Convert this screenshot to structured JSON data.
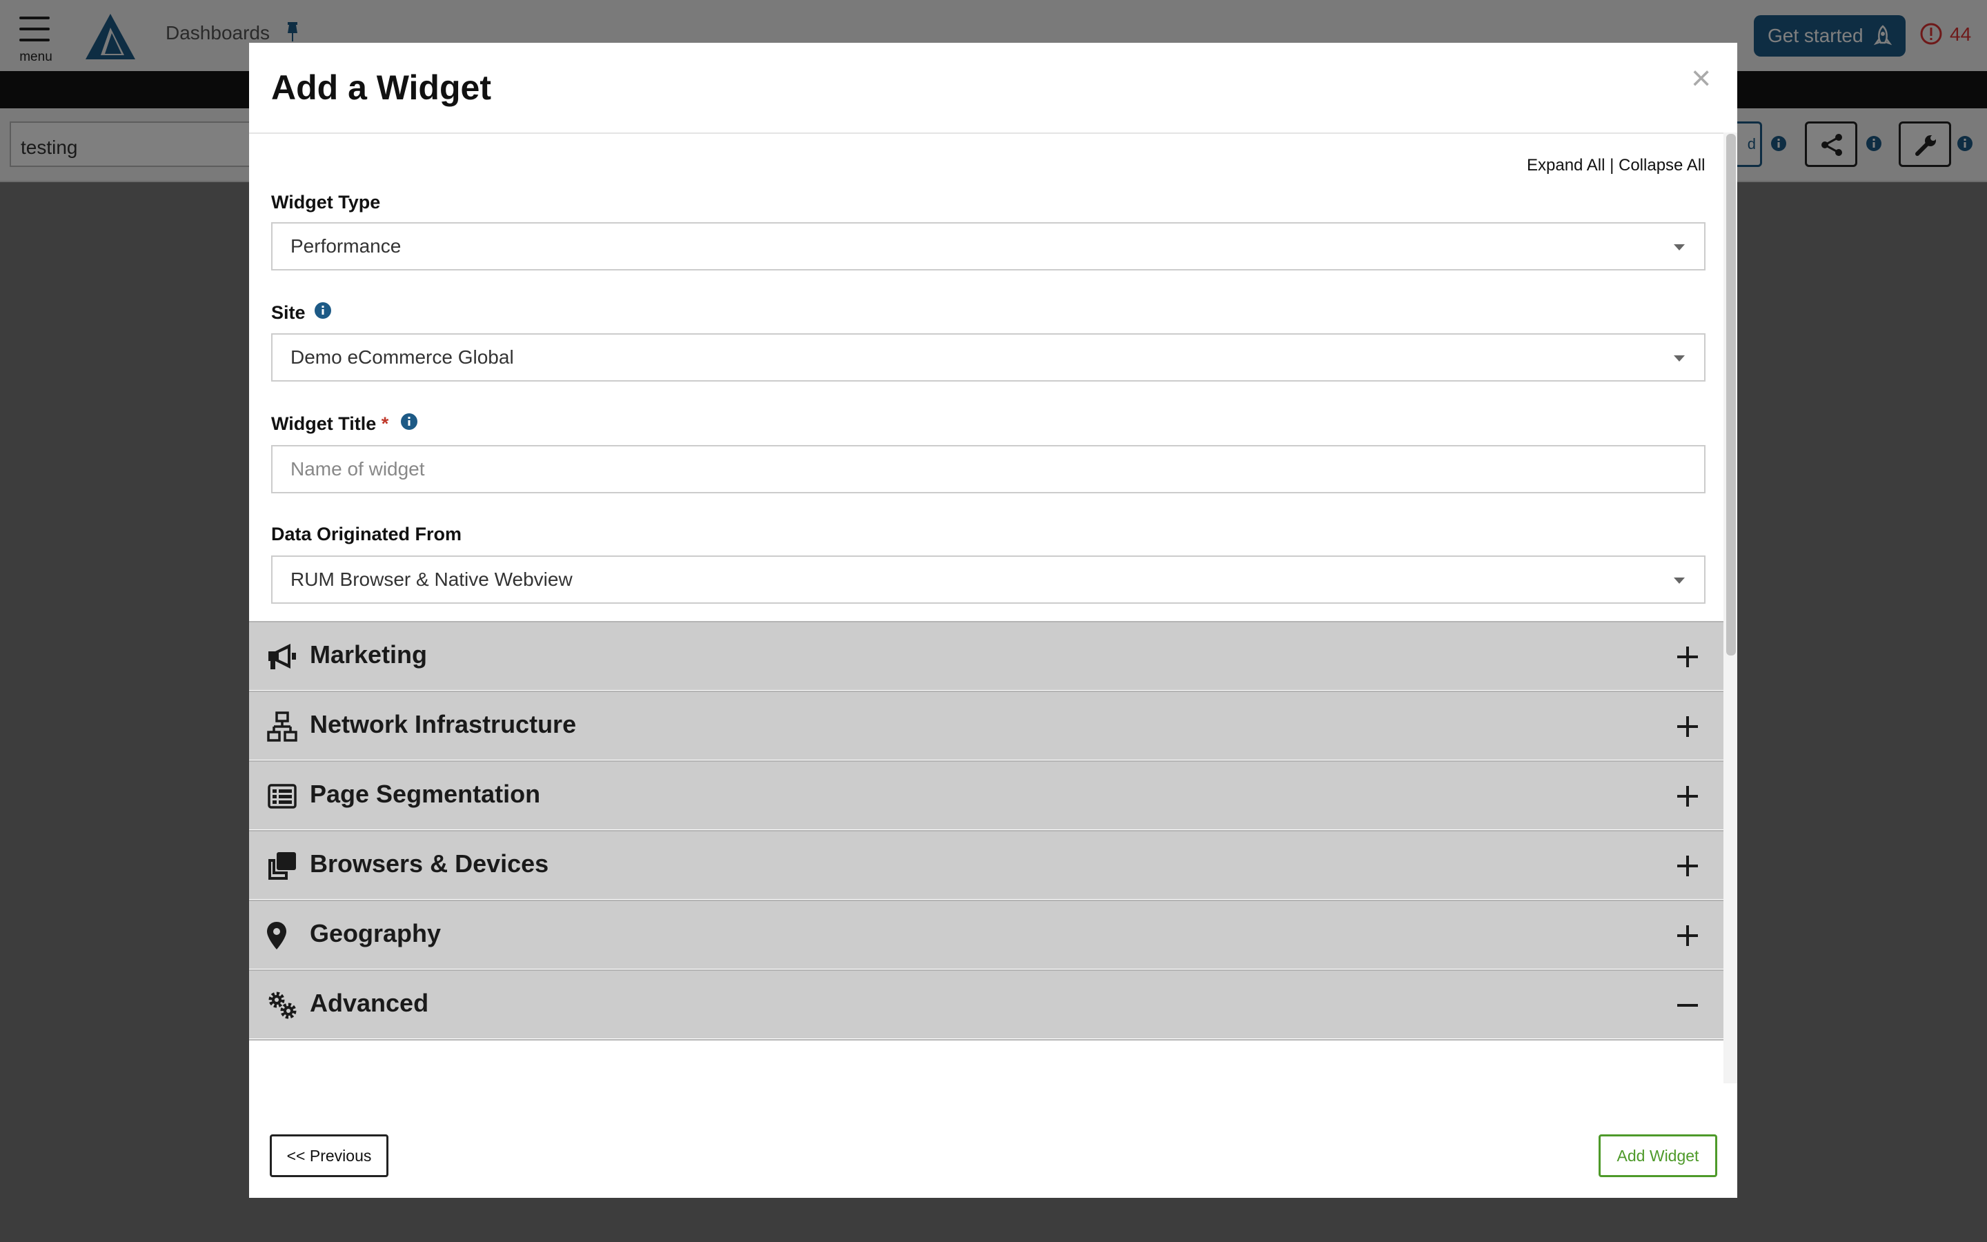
{
  "topbar": {
    "menu_label": "menu",
    "breadcrumb": "Dashboards",
    "get_started_label": "Get started",
    "alert_count": "44"
  },
  "toolbar": {
    "dashboard_name": "testing",
    "partial_button_text": "d"
  },
  "modal": {
    "title": "Add a Widget",
    "close_symbol": "×",
    "expand_all": "Expand All",
    "link_separator": "|",
    "collapse_all": "Collapse All",
    "fields": {
      "widget_type": {
        "label": "Widget Type",
        "value": "Performance"
      },
      "site": {
        "label": "Site",
        "value": "Demo eCommerce Global"
      },
      "widget_title": {
        "label": "Widget Title",
        "required_mark": "*",
        "placeholder": "Name of widget"
      },
      "data_origin": {
        "label": "Data Originated From",
        "value": "RUM Browser & Native Webview"
      }
    },
    "sections": [
      {
        "title": "Marketing",
        "icon": "megaphone-icon",
        "expanded": false
      },
      {
        "title": "Network Infrastructure",
        "icon": "network-icon",
        "expanded": false
      },
      {
        "title": "Page Segmentation",
        "icon": "list-icon",
        "expanded": false
      },
      {
        "title": "Browsers & Devices",
        "icon": "windows-icon",
        "expanded": false
      },
      {
        "title": "Geography",
        "icon": "map-pin-icon",
        "expanded": false
      },
      {
        "title": "Advanced",
        "icon": "gears-icon",
        "expanded": true
      }
    ],
    "buttons": {
      "previous": "<< Previous",
      "add_widget": "Add Widget"
    }
  },
  "colors": {
    "brand_blue": "#1d5a86",
    "alert_red": "#dd3333",
    "add_green": "#4e9a2a",
    "section_gray": "#cccccc"
  }
}
